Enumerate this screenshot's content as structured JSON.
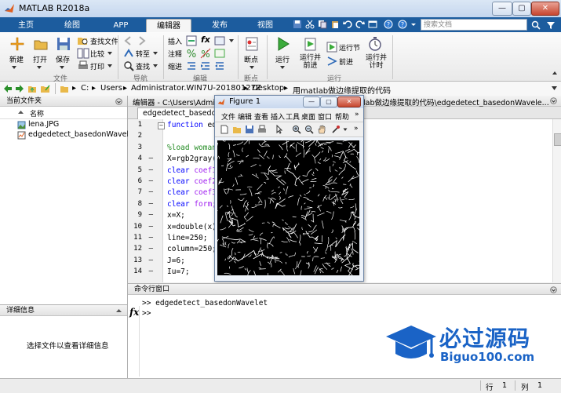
{
  "window": {
    "title": "MATLAB R2018a",
    "minimize": "—",
    "restore": "▢",
    "close": "✕"
  },
  "tabs": [
    {
      "label": "主页"
    },
    {
      "label": "绘图"
    },
    {
      "label": "APP"
    },
    {
      "label": "编辑器"
    },
    {
      "label": "发布"
    },
    {
      "label": "视图"
    }
  ],
  "search": {
    "placeholder": "搜索文档"
  },
  "ribbon": {
    "file": {
      "new": "新建",
      "open": "打开",
      "save": "保存",
      "find_files": "查找文件",
      "compare": "比较",
      "print": "打印",
      "group": "文件"
    },
    "navigate": {
      "goto": "转至",
      "find": "查找",
      "group": "导航"
    },
    "edit": {
      "insert": "插入",
      "comment": "注释",
      "indent": "缩进",
      "fx": "fx",
      "group": "编辑"
    },
    "breakpoints": {
      "label": "断点",
      "group": "断点"
    },
    "run": {
      "run": "运行",
      "run_advance": "运行并\n前进",
      "run_section": "运行节",
      "advance": "前进",
      "run_time": "运行并\n计时",
      "group": "运行"
    }
  },
  "address": [
    "C:",
    "Users",
    "Administrator.WIN7U-20180127Z",
    "Desktop",
    "用matlab做边缘提取的代码"
  ],
  "current_folder": {
    "title": "当前文件夹",
    "column": "名称",
    "files": [
      {
        "name": "lena.JPG"
      },
      {
        "name": "edgedetect_basedonWavel..."
      }
    ]
  },
  "details": {
    "title": "详细信息",
    "message": "选择文件以查看详细信息"
  },
  "editor": {
    "title": "编辑器 - C:\\Users\\Admi",
    "title_right": "lab做边缘提取的代码\\edgedetect_basedonWavele...",
    "tab": "edgedetect_basedon",
    "lines": [
      {
        "n": "1",
        "dash": "",
        "text": "function edg"
      },
      {
        "n": "2",
        "dash": "",
        "text": ""
      },
      {
        "n": "3",
        "dash": "",
        "text": "%load woman"
      },
      {
        "n": "4",
        "dash": "—",
        "text": "X=rgb2gray(i"
      },
      {
        "n": "5",
        "dash": "—",
        "text": "clear coef1"
      },
      {
        "n": "6",
        "dash": "—",
        "text": "clear coef2"
      },
      {
        "n": "7",
        "dash": "—",
        "text": "clear coef3"
      },
      {
        "n": "8",
        "dash": "—",
        "text": "clear form;"
      },
      {
        "n": "9",
        "dash": "—",
        "text": "x=X;"
      },
      {
        "n": "10",
        "dash": "—",
        "text": "x=double(x)"
      },
      {
        "n": "11",
        "dash": "—",
        "text": "line=250;"
      },
      {
        "n": "12",
        "dash": "—",
        "text": "column=250;"
      },
      {
        "n": "13",
        "dash": "—",
        "text": "J=6;"
      },
      {
        "n": "14",
        "dash": "—",
        "text": "Iu=7;"
      }
    ]
  },
  "command_window": {
    "title": "命令行窗口",
    "history": ">> edgedetect_basedonWavelet",
    "prompt": ">>",
    "fx": "fx"
  },
  "figure": {
    "title": "Figure 1",
    "menu": [
      "文件",
      "编辑",
      "查看",
      "插入",
      "工具",
      "桌面",
      "窗口",
      "帮助"
    ],
    "more": "»"
  },
  "status": {
    "row_label": "行",
    "row": "1",
    "col_label": "列",
    "col": "1"
  },
  "watermark": {
    "brand": "必过源码",
    "url": "Biguo100.com"
  },
  "colors": {
    "tab_blue": "#1c5c9e",
    "watermark_blue": "#1a63c6",
    "keyword_blue": "#0000ff",
    "comment_green": "#228b22"
  }
}
